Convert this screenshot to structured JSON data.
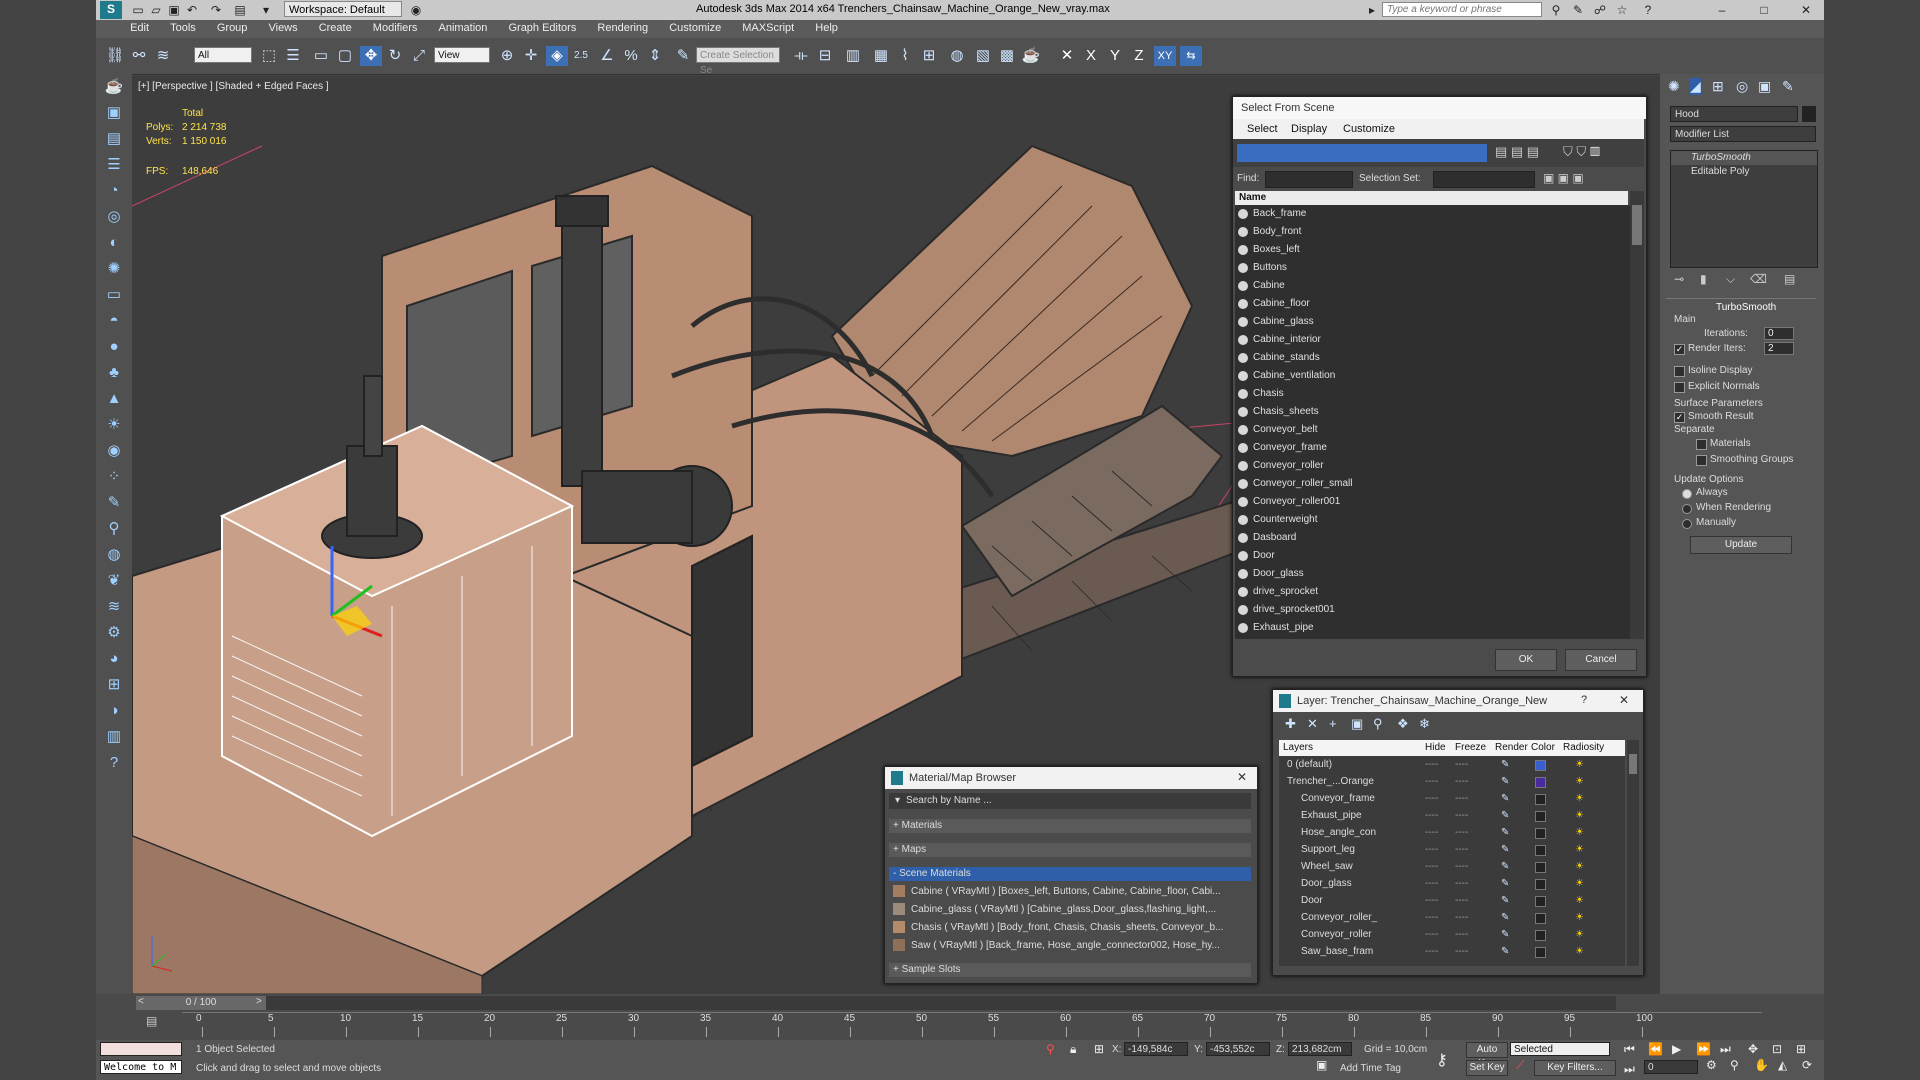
{
  "app": {
    "title": "Autodesk 3ds Max  2014 x64     Trenchers_Chainsaw_Machine_Orange_New_vray.max",
    "workspace": "Workspace: Default",
    "search_placeholder": "Type a keyword or phrase"
  },
  "menu": [
    "Edit",
    "Tools",
    "Group",
    "Views",
    "Create",
    "Modifiers",
    "Animation",
    "Graph Editors",
    "Rendering",
    "Customize",
    "MAXScript",
    "Help"
  ],
  "toolbar": {
    "filter": "All",
    "refcoord": "View",
    "selset": "Create Selection Se",
    "snap_label": "2.5",
    "axes": [
      "X",
      "Y",
      "Z",
      "XY"
    ]
  },
  "viewport": {
    "label": "[+] [Perspective ] [Shaded + Edged Faces ]",
    "stats": {
      "total": "Total",
      "polys_label": "Polys:",
      "polys": "2 214 738",
      "verts_label": "Verts:",
      "verts": "1 150 016",
      "fps_label": "FPS:",
      "fps": "148,646"
    }
  },
  "select_from_scene": {
    "title": "Select From Scene",
    "tabs": [
      "Select",
      "Display",
      "Customize"
    ],
    "find_label": "Find:",
    "selset_label": "Selection Set:",
    "column": "Name",
    "items": [
      "Back_frame",
      "Body_front",
      "Boxes_left",
      "Buttons",
      "Cabine",
      "Cabine_floor",
      "Cabine_glass",
      "Cabine_interior",
      "Cabine_stands",
      "Cabine_ventilation",
      "Chasis",
      "Chasis_sheets",
      "Conveyor_belt",
      "Conveyor_frame",
      "Conveyor_roller",
      "Conveyor_roller_small",
      "Conveyor_roller001",
      "Counterweight",
      "Dasboard",
      "Door",
      "Door_glass",
      "drive_sprocket",
      "drive_sprocket001",
      "Exhaust_pipe"
    ],
    "ok": "OK",
    "cancel": "Cancel"
  },
  "layer_dialog": {
    "title": "Layer: Trencher_Chainsaw_Machine_Orange_New",
    "columns": [
      "Layers",
      "Hide",
      "Freeze",
      "Render",
      "Color",
      "Radiosity"
    ],
    "rows": [
      {
        "name": "0 (default)",
        "indent": 0,
        "color": "#3a5fcf"
      },
      {
        "name": "Trencher_...Orange",
        "indent": 0,
        "color": "#4a2aa0"
      },
      {
        "name": "Conveyor_frame",
        "indent": 1,
        "color": "#222"
      },
      {
        "name": "Exhaust_pipe",
        "indent": 1,
        "color": "#222"
      },
      {
        "name": "Hose_angle_con",
        "indent": 1,
        "color": "#222"
      },
      {
        "name": "Support_leg",
        "indent": 1,
        "color": "#222"
      },
      {
        "name": "Wheel_saw",
        "indent": 1,
        "color": "#222"
      },
      {
        "name": "Door_glass",
        "indent": 1,
        "color": "#222"
      },
      {
        "name": "Door",
        "indent": 1,
        "color": "#222"
      },
      {
        "name": "Conveyor_roller_",
        "indent": 1,
        "color": "#222"
      },
      {
        "name": "Conveyor_roller",
        "indent": 1,
        "color": "#222"
      },
      {
        "name": "Saw_base_fram",
        "indent": 1,
        "color": "#222"
      }
    ],
    "dots": "----"
  },
  "material_browser": {
    "title": "Material/Map Browser",
    "search": "Search by Name ...",
    "groups": [
      "+ Materials",
      "+ Maps",
      "- Scene Materials",
      "+ Sample Slots"
    ],
    "materials": [
      "Cabine  ( VRayMtl )  [Boxes_left, Buttons, Cabine, Cabine_floor, Cabi...",
      "Cabine_glass  ( VRayMtl )  [Cabine_glass,Door_glass,flashing_light,...",
      "Chasis  ( VRayMtl )  [Body_front, Chasis, Chasis_sheets, Conveyor_b...",
      "Saw  ( VRayMtl )  [Back_frame, Hose_angle_connector002, Hose_hy..."
    ]
  },
  "command_panel": {
    "object_name": "Hood",
    "modifier_list": "Modifier List",
    "stack": [
      "TurboSmooth",
      "Editable Poly"
    ],
    "rollout_title": "TurboSmooth",
    "main": "Main",
    "iterations_label": "Iterations:",
    "iterations": "0",
    "render_iters_label": "Render Iters:",
    "render_iters": "2",
    "isoline": "Isoline Display",
    "explicit": "Explicit Normals",
    "surface": "Surface Parameters",
    "smooth_result": "Smooth Result",
    "separate": "Separate",
    "materials": "Materials",
    "smoothing_groups": "Smoothing Groups",
    "update_options": "Update Options",
    "always": "Always",
    "when_rendering": "When Rendering",
    "manually": "Manually",
    "update": "Update"
  },
  "timeline": {
    "frame": "0 / 100",
    "ticks": [
      "0",
      "5",
      "10",
      "15",
      "20",
      "25",
      "30",
      "35",
      "40",
      "45",
      "50",
      "55",
      "60",
      "65",
      "70",
      "75",
      "80",
      "85",
      "90",
      "95",
      "100"
    ]
  },
  "status": {
    "selected": "1 Object Selected",
    "hint": "Click and drag to select and move objects",
    "welcome": "Welcome to M",
    "x": "-149,584c",
    "y": "-453,552c",
    "z": "213,682cm",
    "grid": "Grid = 10,0cm",
    "auto_key": "Auto Key",
    "selected_mode": "Selected",
    "set_key": "Set Key",
    "key_filters": "Key Filters...",
    "add_time_tag": "Add Time Tag",
    "frame_value": "0"
  }
}
